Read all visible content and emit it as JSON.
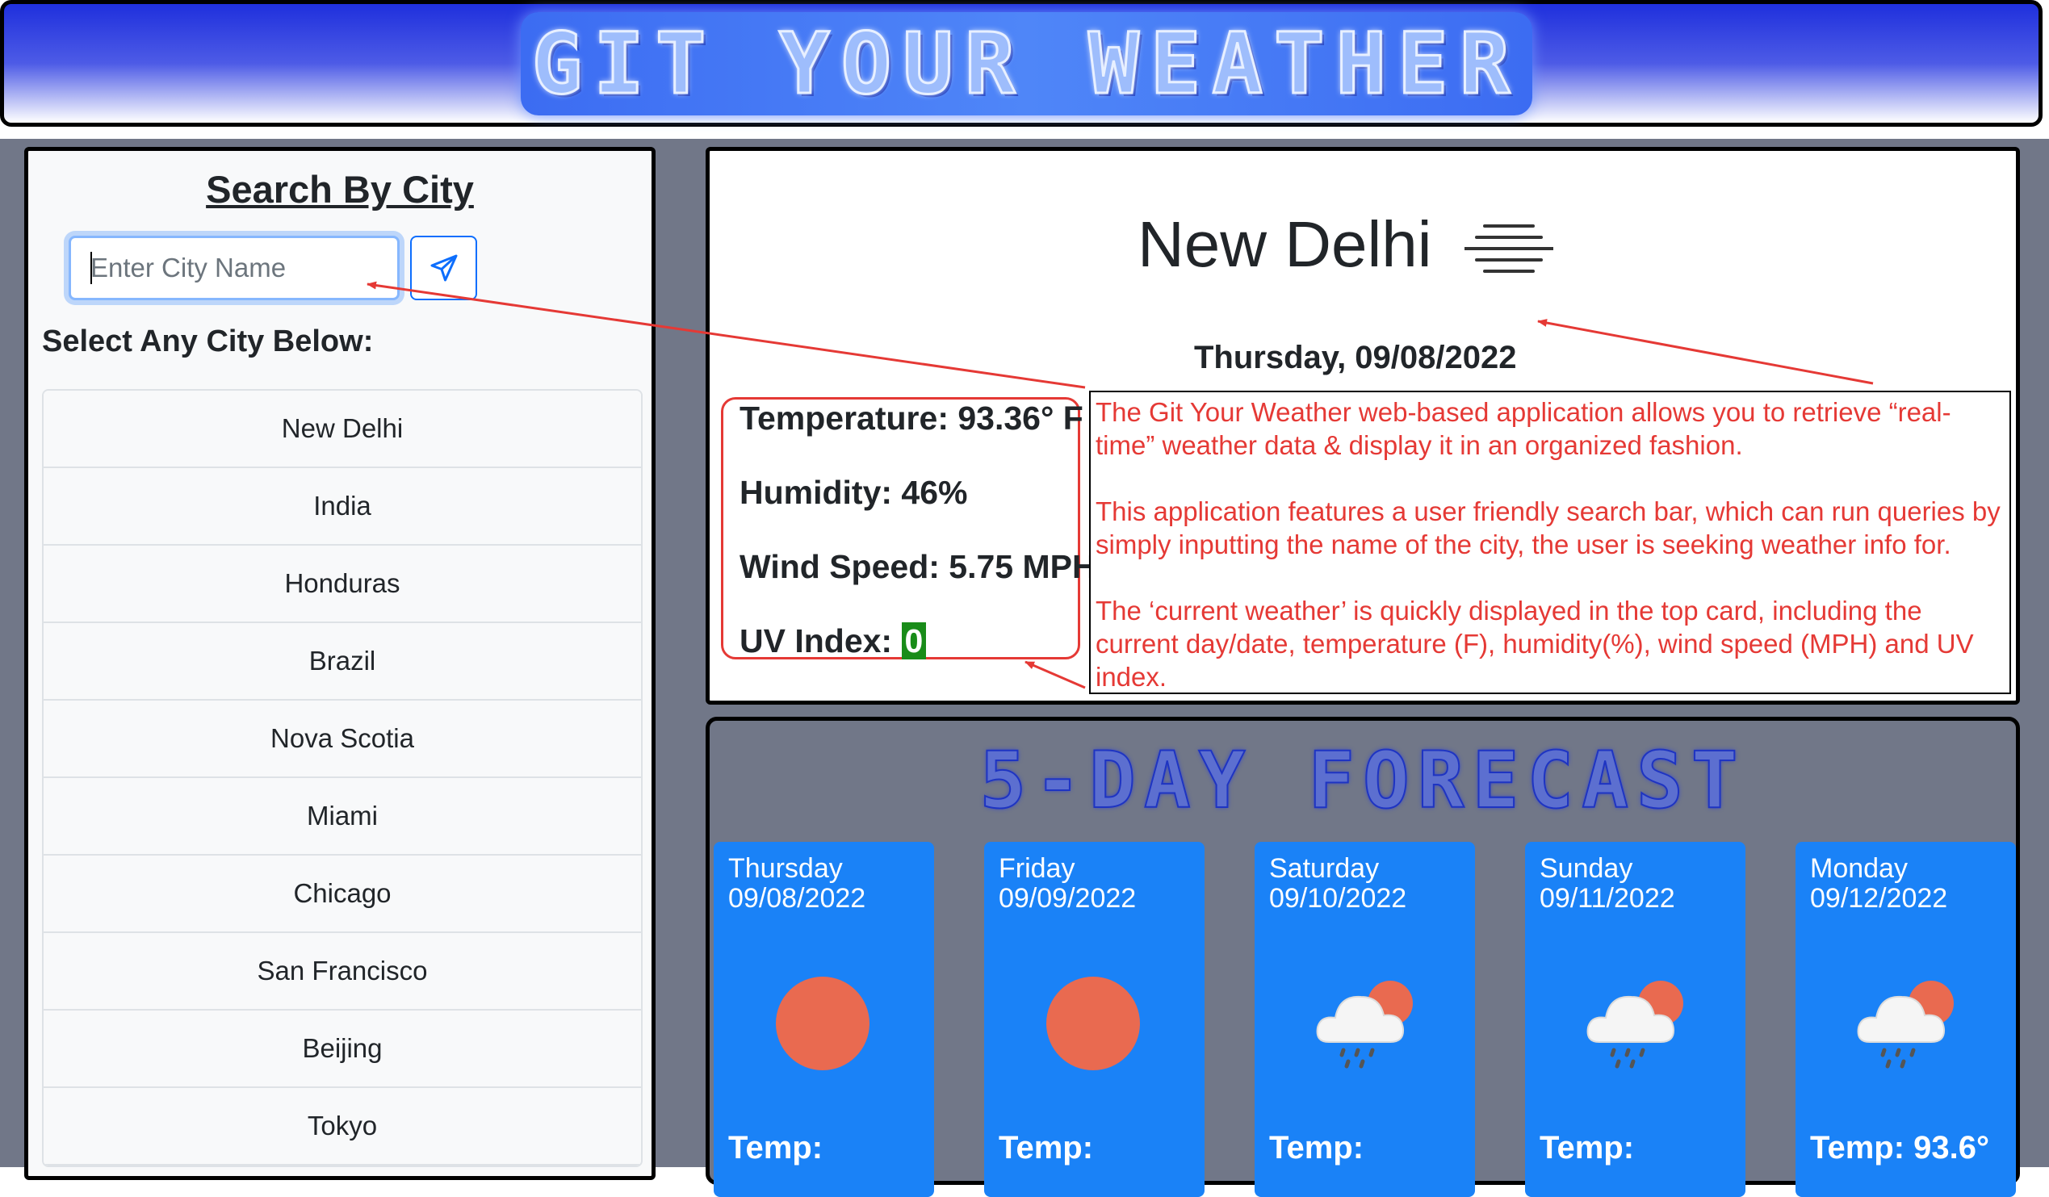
{
  "header": {
    "title": "GIT YOUR WEATHER"
  },
  "search": {
    "title": "Search By City",
    "placeholder": "Enter City Name",
    "select_label": "Select Any City Below:",
    "cities": [
      "New Delhi",
      "India",
      "Honduras",
      "Brazil",
      "Nova Scotia",
      "Miami",
      "Chicago",
      "San Francisco",
      "Beijing",
      "Tokyo"
    ]
  },
  "current": {
    "city": "New Delhi",
    "icon": "mist-icon",
    "date": "Thursday, 09/08/2022",
    "temperature": "Temperature: 93.36° F",
    "humidity": "Humidity: 46%",
    "wind": "Wind Speed: 5.75 MPH",
    "uv_label": "UV Index:",
    "uv_value": "0",
    "uv_color": "#198c19"
  },
  "annotation": {
    "paragraphs": [
      "The Git Your Weather web-based application allows you to retrieve “real-time” weather data & display it in an organized fashion.",
      "This application features a user friendly search bar, which can run queries by simply inputting the name of the city, the user is seeking weather info for.",
      "The ‘current weather’ is quickly displayed in the top card, including the current day/date, temperature (F), humidity(%), wind speed (MPH) and UV index."
    ],
    "color": "#e53935"
  },
  "forecast": {
    "title": "5-DAY FORECAST",
    "days": [
      {
        "day": "Thursday",
        "date": "09/08/2022",
        "icon": "sun-icon",
        "temp": "Temp:"
      },
      {
        "day": "Friday",
        "date": "09/09/2022",
        "icon": "sun-icon",
        "temp": "Temp:"
      },
      {
        "day": "Saturday",
        "date": "09/10/2022",
        "icon": "rain-cloud-icon",
        "temp": "Temp:"
      },
      {
        "day": "Sunday",
        "date": "09/11/2022",
        "icon": "rain-cloud-icon",
        "temp": "Temp:"
      },
      {
        "day": "Monday",
        "date": "09/12/2022",
        "icon": "rain-cloud-icon",
        "temp": "Temp: 93.6°"
      }
    ]
  }
}
